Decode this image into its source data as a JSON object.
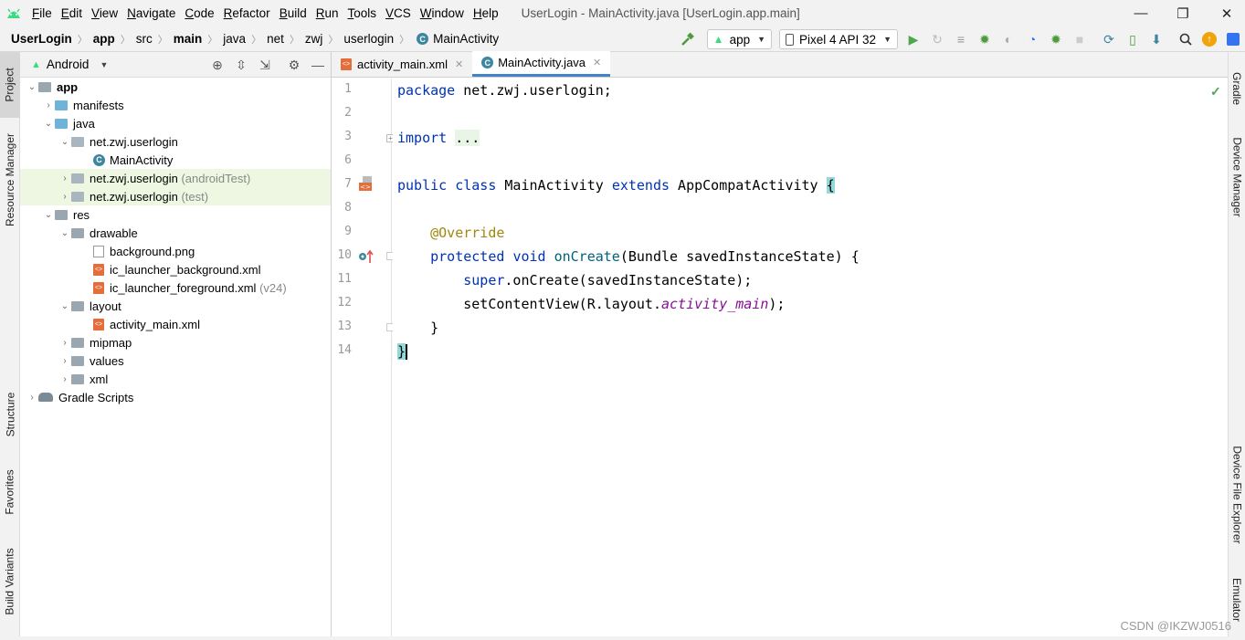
{
  "menu": [
    "File",
    "Edit",
    "View",
    "Navigate",
    "Code",
    "Refactor",
    "Build",
    "Run",
    "Tools",
    "VCS",
    "Window",
    "Help"
  ],
  "window_title": "UserLogin - MainActivity.java [UserLogin.app.main]",
  "window_controls": {
    "minimize": "—",
    "restore": "❐",
    "close": "✕"
  },
  "breadcrumb": [
    {
      "label": "UserLogin",
      "bold": true
    },
    {
      "label": "app",
      "bold": true
    },
    {
      "label": "src",
      "bold": false
    },
    {
      "label": "main",
      "bold": true
    },
    {
      "label": "java",
      "bold": false
    },
    {
      "label": "net",
      "bold": false
    },
    {
      "label": "zwj",
      "bold": false
    },
    {
      "label": "userlogin",
      "bold": false
    },
    {
      "label": "MainActivity",
      "bold": false
    }
  ],
  "toolbar": {
    "run_config": "app",
    "device": "Pixel 4 API 32"
  },
  "left_tabs": [
    "Project",
    "Resource Manager",
    "Structure",
    "Favorites",
    "Build Variants"
  ],
  "right_tabs": [
    "Gradle",
    "Device Manager",
    "Device File Explorer",
    "Emulator"
  ],
  "project_panel": {
    "view_mode": "Android"
  },
  "tree": [
    {
      "label": "app",
      "suffix": "",
      "bold": true
    },
    {
      "label": "manifests",
      "suffix": ""
    },
    {
      "label": "java",
      "suffix": ""
    },
    {
      "label": "net.zwj.userlogin",
      "suffix": ""
    },
    {
      "label": "MainActivity",
      "suffix": ""
    },
    {
      "label": "net.zwj.userlogin",
      "suffix": "(androidTest)"
    },
    {
      "label": "net.zwj.userlogin",
      "suffix": "(test)"
    },
    {
      "label": "res",
      "suffix": ""
    },
    {
      "label": "drawable",
      "suffix": ""
    },
    {
      "label": "background.png",
      "suffix": ""
    },
    {
      "label": "ic_launcher_background.xml",
      "suffix": ""
    },
    {
      "label": "ic_launcher_foreground.xml",
      "suffix": "(v24)"
    },
    {
      "label": "layout",
      "suffix": ""
    },
    {
      "label": "activity_main.xml",
      "suffix": ""
    },
    {
      "label": "mipmap",
      "suffix": ""
    },
    {
      "label": "values",
      "suffix": ""
    },
    {
      "label": "xml",
      "suffix": ""
    },
    {
      "label": "Gradle Scripts",
      "suffix": ""
    }
  ],
  "editor_tabs": [
    {
      "label": "activity_main.xml",
      "active": false
    },
    {
      "label": "MainActivity.java",
      "active": true
    }
  ],
  "line_numbers": [
    "1",
    "2",
    "3",
    "6",
    "7",
    "8",
    "9",
    "10",
    "11",
    "12",
    "13",
    "14"
  ],
  "code": {
    "l1_kw": "package",
    "l1_rest": " net.zwj.userlogin;",
    "l3_kw": "import",
    "l3_fold": "...",
    "l7_kw1": "public",
    "l7_kw2": "class",
    "l7_name": " MainActivity ",
    "l7_kw3": "extends",
    "l7_super": " AppCompatActivity ",
    "l7_brace": "{",
    "l9_ann": "@Override",
    "l10_kw1": "protected",
    "l10_kw2": "void",
    "l10_fn": "onCreate",
    "l10_rest": "(Bundle savedInstanceState) {",
    "l11_kw": "super",
    "l11_rest": ".onCreate(savedInstanceState);",
    "l12_a": "setContentView(R.layout.",
    "l12_it": "activity_main",
    "l12_b": ");",
    "l13": "}",
    "l14": "}"
  },
  "watermark": "CSDN @IKZWJ0516",
  "colors": {
    "keyword": "#0033b3",
    "annotation": "#9e880d",
    "function": "#00627a",
    "italic_field": "#871094",
    "tab_active": "#4083c9"
  }
}
